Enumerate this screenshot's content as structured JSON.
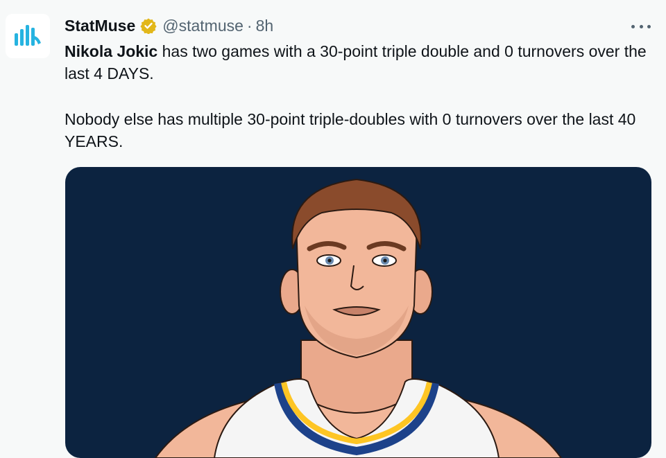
{
  "tweet": {
    "author": {
      "display_name": "StatMuse",
      "handle": "@statmuse",
      "separator": "·",
      "time": "8h",
      "verified_icon": "verified-badge-icon",
      "avatar_icon": "statmuse-logo-icon"
    },
    "more_icon": "more-options-icon",
    "text": {
      "p1_bold": "Nikola Jokic",
      "p1_rest": " has two games with a 30-point triple double and 0 turnovers over the last 4 DAYS.",
      "p2": "Nobody else has multiple 30-point triple-doubles with 0 turnovers over the last 40 YEARS."
    },
    "media": {
      "kind": "player-illustration",
      "colors": {
        "background": "#0c2340",
        "jersey": "#f5f5f5",
        "trim_gold": "#fec524",
        "trim_blue": "#1d428a",
        "skin": "#f2b79a",
        "hair": "#8a4b2c"
      }
    },
    "colors": {
      "page_bg": "#f7f9f9",
      "text": "#0f1419",
      "muted": "#536471",
      "verified_gold": "#e2b719",
      "logo_teal": "#26b3e0"
    }
  }
}
